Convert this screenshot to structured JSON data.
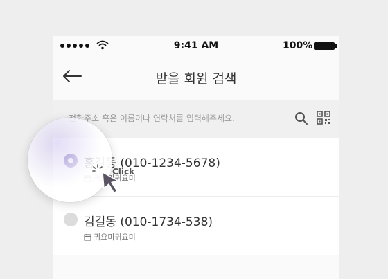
{
  "status_bar": {
    "time": "9:41 AM",
    "battery": "100%"
  },
  "header": {
    "title": "받을 회원 검색"
  },
  "search": {
    "placeholder": "전화주소 혹은 이름이나 연락처를 입력해주세요."
  },
  "results": [
    {
      "name_phone": "홍길동 (010-1234-5678)",
      "nickname": "귀요미귀요미",
      "selected": true
    },
    {
      "name_phone": "김길동 (010-1734-538)",
      "nickname": "귀요미귀요미",
      "selected": false
    }
  ],
  "overlay": {
    "click_label": "Click"
  },
  "colors": {
    "accent": "#6c5bb4",
    "background": "#eeeeee",
    "panel": "#fafafa"
  },
  "icons": [
    "signal-dots-icon",
    "wifi-icon",
    "battery-icon",
    "back-arrow-icon",
    "search-icon",
    "qr-code-icon",
    "calendar-icon",
    "cursor-icon"
  ]
}
